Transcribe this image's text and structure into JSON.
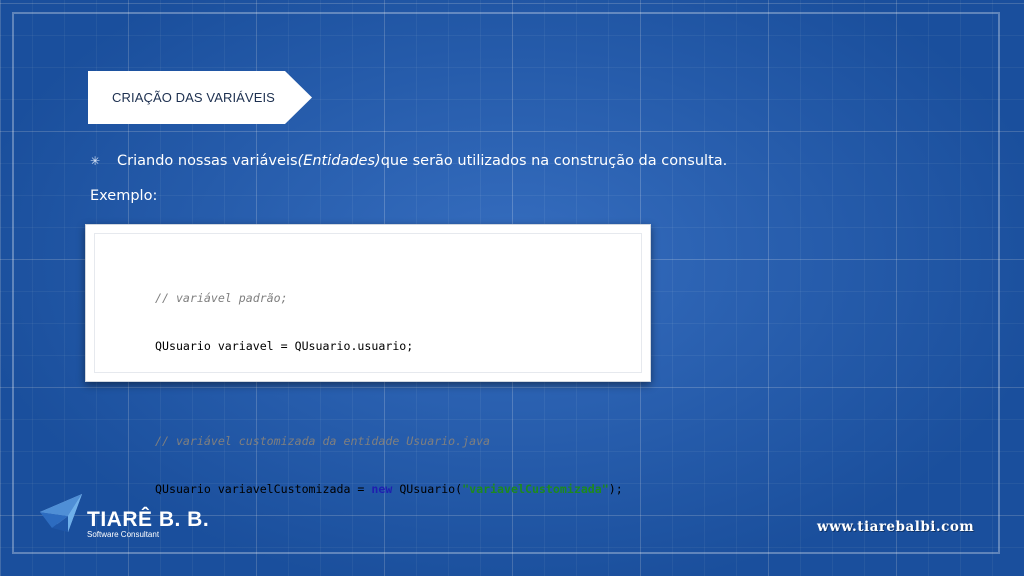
{
  "slide": {
    "section_title": "CRIAÇÃO DAS VARIÁVEIS",
    "bullet": {
      "icon": "asterisk-icon",
      "text_before": "Criando nossas variáveis ",
      "text_emphasis": "(Entidades)",
      "text_after": " que serão utilizados na construção da consulta."
    },
    "example_label": "Exemplo:",
    "code": {
      "line1_comment": "// variável padrão;",
      "line2": "QUsuario variavel = QUsuario.usuario;",
      "line3_comment": "// variável customizada da entidade Usuario.java",
      "line4_prefix": "QUsuario variavelCustomizada = ",
      "line4_keyword": "new",
      "line4_call": " QUsuario(",
      "line4_string": "\"variavelCustomizada\"",
      "line4_suffix": ");"
    }
  },
  "branding": {
    "logo_icon": "paper-plane-logo-icon",
    "name": "TIARÊ B. B.",
    "subtitle": "Software Consultant",
    "website": "www.tiarebalbi.com"
  },
  "colors": {
    "background": "#1f5db8",
    "code_keyword": "#1f1fb0",
    "code_string": "#1d8a1d",
    "code_comment": "#7f7f7f"
  }
}
